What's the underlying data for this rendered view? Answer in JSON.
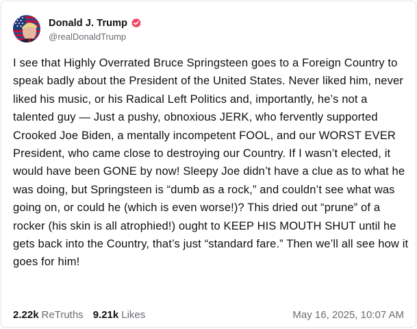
{
  "author": {
    "display_name": "Donald J. Trump",
    "handle": "@realDonaldTrump",
    "verified_icon": "verified-badge-icon",
    "badge_color": "#f0425f"
  },
  "post": {
    "text": "I see that Highly Overrated Bruce Springsteen goes to a Foreign Country to speak badly about the President of the United States. Never liked him, never liked his music, or his Radical Left Politics and, importantly, he’s not a talented guy — Just a pushy, obnoxious JERK, who fervently supported Crooked Joe Biden, a mentally incompetent FOOL, and our WORST EVER President, who came close to destroying our Country. If I wasn’t elected, it would have been GONE by now! Sleepy Joe didn’t have a clue as to what he was doing, but Springsteen is “dumb as a rock,” and couldn’t see what was going on, or could he (which is even worse!)? This dried out “prune” of a rocker (his skin is all atrophied!) ought to KEEP HIS MOUTH SHUT until he gets back into the Country, that’s just “standard fare.” Then we’ll all see how it goes for him!"
  },
  "stats": {
    "retruths_count": "2.22k",
    "retruths_label": "ReTruths",
    "likes_count": "9.21k",
    "likes_label": "Likes"
  },
  "timestamp": "May 16, 2025, 10:07 AM",
  "colors": {
    "text": "#0f0f10",
    "muted": "#6b6b73",
    "border": "#e4e4e7"
  }
}
